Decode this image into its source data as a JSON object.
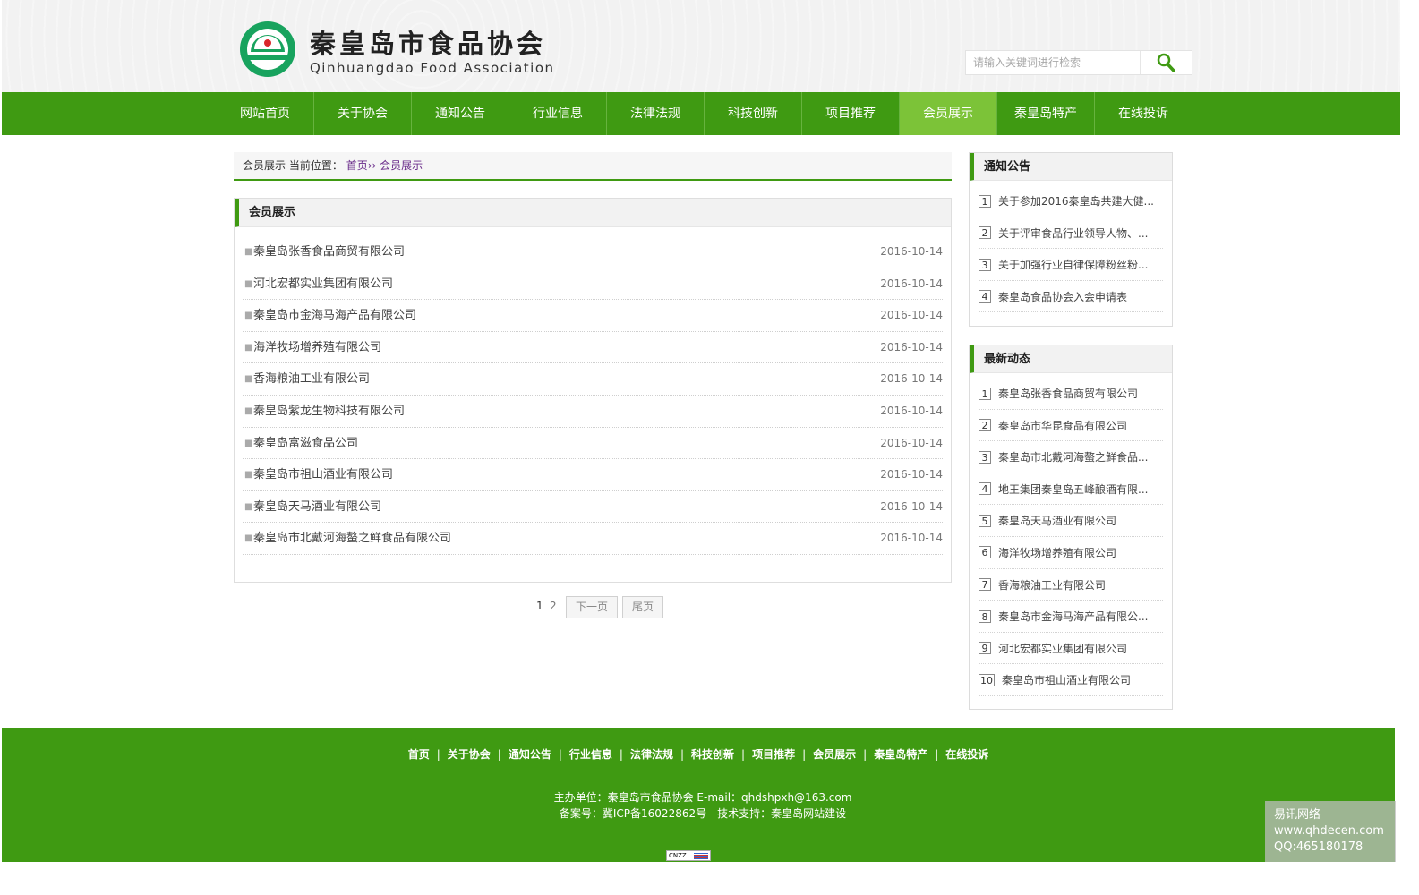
{
  "header": {
    "logo_cn": "秦皇岛市食品协会",
    "logo_en": "Qinhuangdao Food Association",
    "search_placeholder": "请输入关键词进行检索"
  },
  "nav": {
    "items": [
      "网站首页",
      "关于协会",
      "通知公告",
      "行业信息",
      "法律法规",
      "科技创新",
      "项目推荐",
      "会员展示",
      "秦皇岛特产",
      "在线投诉"
    ],
    "active_index": 7
  },
  "breadcrumb": {
    "section": "会员展示",
    "prefix": "当前位置：",
    "home": "首页",
    "sep": "››",
    "current": "会员展示"
  },
  "main": {
    "title": "会员展示",
    "items": [
      {
        "title": "秦皇岛张香食品商贸有限公司",
        "date": "2016-10-14"
      },
      {
        "title": "河北宏都实业集团有限公司",
        "date": "2016-10-14"
      },
      {
        "title": "秦皇岛市金海马海产品有限公司",
        "date": "2016-10-14"
      },
      {
        "title": "海洋牧场增养殖有限公司",
        "date": "2016-10-14"
      },
      {
        "title": "香海粮油工业有限公司",
        "date": "2016-10-14"
      },
      {
        "title": "秦皇岛紫龙生物科技有限公司",
        "date": "2016-10-14"
      },
      {
        "title": "秦皇岛富滋食品公司",
        "date": "2016-10-14"
      },
      {
        "title": "秦皇岛市祖山酒业有限公司",
        "date": "2016-10-14"
      },
      {
        "title": "秦皇岛天马酒业有限公司",
        "date": "2016-10-14"
      },
      {
        "title": "秦皇岛市北戴河海螯之鲜食品有限公司",
        "date": "2016-10-14"
      }
    ]
  },
  "pager": {
    "current": "1",
    "page2": "2",
    "next": "下一页",
    "last": "尾页"
  },
  "sidebar": {
    "notice": {
      "title": "通知公告",
      "items": [
        {
          "num": "1",
          "text": "关于参加2016秦皇岛共建大健..."
        },
        {
          "num": "2",
          "text": "关于评审食品行业领导人物、..."
        },
        {
          "num": "3",
          "text": "关于加强行业自律保障粉丝粉..."
        },
        {
          "num": "4",
          "text": "秦皇岛食品协会入会申请表"
        }
      ]
    },
    "latest": {
      "title": "最新动态",
      "items": [
        {
          "num": "1",
          "text": "秦皇岛张香食品商贸有限公司"
        },
        {
          "num": "2",
          "text": "秦皇岛市华昆食品有限公司"
        },
        {
          "num": "3",
          "text": "秦皇岛市北戴河海螯之鲜食品..."
        },
        {
          "num": "4",
          "text": "地王集团秦皇岛五峰酿酒有限..."
        },
        {
          "num": "5",
          "text": "秦皇岛天马酒业有限公司"
        },
        {
          "num": "6",
          "text": "海洋牧场增养殖有限公司"
        },
        {
          "num": "7",
          "text": "香海粮油工业有限公司"
        },
        {
          "num": "8",
          "text": "秦皇岛市金海马海产品有限公..."
        },
        {
          "num": "9",
          "text": "河北宏都实业集团有限公司"
        },
        {
          "num": "10",
          "text": "秦皇岛市祖山酒业有限公司"
        }
      ]
    }
  },
  "footer": {
    "links": [
      "首页",
      "关于协会",
      "通知公告",
      "行业信息",
      "法律法规",
      "科技创新",
      "项目推荐",
      "会员展示",
      "秦皇岛特产",
      "在线投诉"
    ],
    "separator": "|",
    "line1": "主办单位：秦皇岛市食品协会 E-mail：qhdshpxh@163.com",
    "line2": "备案号：冀ICP备16022862号　技术支持：秦皇岛网站建设",
    "cnzz": "CNZZ"
  },
  "watermark": {
    "line1": "易讯网络",
    "line2": "www.qhdecen.com",
    "line3": "QQ:465180178"
  },
  "colors": {
    "brand_green": "#3f9a12",
    "nav_active": "#7cc338"
  }
}
